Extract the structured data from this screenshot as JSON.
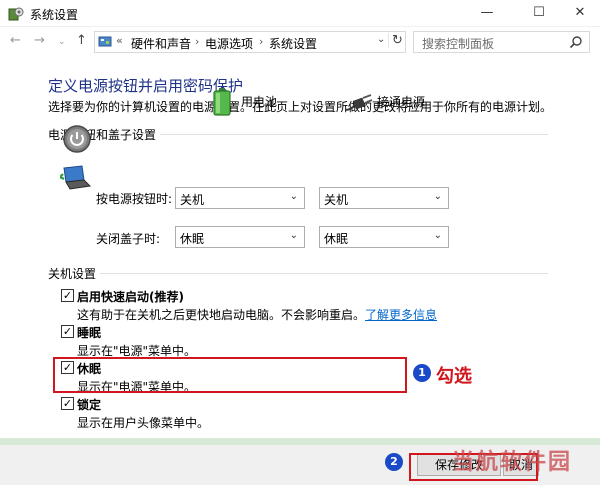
{
  "window": {
    "title": "系统设置",
    "controls": {
      "minimize": "—",
      "maximize": "☐",
      "close": "✕"
    }
  },
  "nav": {
    "back": "←",
    "forward": "→",
    "recent": "⌄",
    "up": "↑",
    "breadcrumb_chevron": "«",
    "breadcrumb": [
      "硬件和声音",
      "电源选项",
      "系统设置"
    ],
    "breadcrumb_separator": "›",
    "dropdown": "⌄",
    "refresh": "↻",
    "search_placeholder": "搜索控制面板"
  },
  "main": {
    "heading": "定义电源按钮并启用密码保护",
    "description": "选择要为你的计算机设置的电源设置。在此页上对设置所做的更改将应用于你所有的电源计划。",
    "power_section": {
      "title": "电源按钮和盖子设置",
      "columns": [
        "用电池",
        "接通电源"
      ],
      "rows": [
        {
          "label": "按电源按钮时:",
          "battery": "关机",
          "plugged": "关机"
        },
        {
          "label": "关闭盖子时:",
          "battery": "休眠",
          "plugged": "休眠"
        }
      ],
      "dropdown_arrow": "⌄"
    },
    "shutdown_section": {
      "title": "关机设置",
      "options": [
        {
          "label": "启用快速启动(推荐)",
          "desc": "这有助于在关机之后更快地启动电脑。不会影响重启。",
          "link": "了解更多信息",
          "checked": true
        },
        {
          "label": "睡眠",
          "desc": "显示在\"电源\"菜单中。",
          "checked": true
        },
        {
          "label": "休眠",
          "desc": "显示在\"电源\"菜单中。",
          "checked": true
        },
        {
          "label": "锁定",
          "desc": "显示在用户头像菜单中。",
          "checked": true
        }
      ],
      "check_mark": "✓"
    }
  },
  "annotations": {
    "step1_number": "1",
    "step1_text": "勾选",
    "step2_number": "2",
    "highlight_color": "#d1171d",
    "badge_color": "#1a4ac7"
  },
  "footer": {
    "save_label": "保存修改",
    "cancel_label": "取消"
  },
  "watermark": "当航软件园",
  "colors": {
    "heading": "#1e3287",
    "link": "#0066cc",
    "bottom_strip": "#d7ead8"
  }
}
